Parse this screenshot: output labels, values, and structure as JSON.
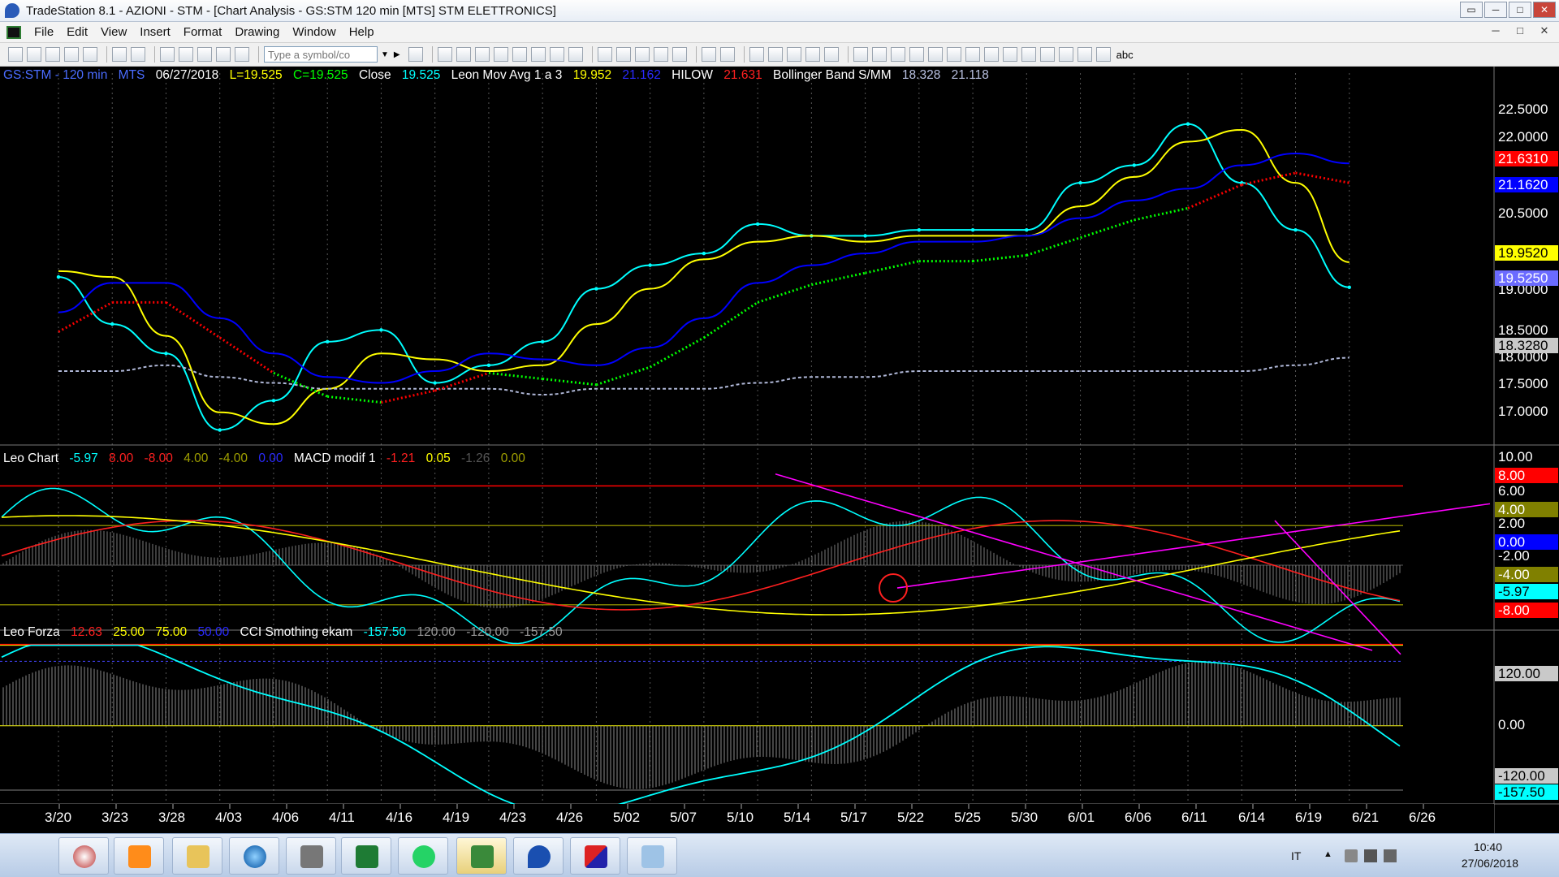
{
  "window": {
    "title": "TradeStation 8.1 - AZIONI - STM - [Chart Analysis - GS:STM  120 min  [MTS] STM ELETTRONICS]",
    "buttons": [
      "▭",
      "─",
      "□",
      "✕"
    ]
  },
  "menu": {
    "items": [
      "File",
      "Edit",
      "View",
      "Insert",
      "Format",
      "Drawing",
      "Window",
      "Help"
    ],
    "mdi_buttons": [
      "─",
      "□",
      "✕"
    ]
  },
  "toolbar": {
    "symbol_placeholder": "Type a symbol/co",
    "abc_label": "abc"
  },
  "price_panel": {
    "header": {
      "symbol": "GS:STM - 120 min",
      "mts": "MTS",
      "date": "06/27/2018",
      "low": "L=19.525",
      "close_val": "C=19.525",
      "close_label": "Close",
      "close": "19.525",
      "leon_label": "Leon Mov Avg 1 a 3",
      "leon1": "19.952",
      "leon2": "21.162",
      "hilow_label": "HILOW",
      "hilow": "21.631",
      "bb_label": "Bollinger Band S/MM",
      "bb1": "18.328",
      "bb2": "21.118"
    },
    "axis_ticks": [
      "22.5000",
      "22.0000",
      "20.5000",
      "19.0000",
      "18.5000",
      "18.0000",
      "17.5000",
      "17.0000"
    ],
    "tags": [
      {
        "text": "21.6310",
        "bg": "#ff0000",
        "color": "#ffffff"
      },
      {
        "text": "21.1620",
        "bg": "#0000ff",
        "color": "#ffffff"
      },
      {
        "text": "19.9520",
        "bg": "#ffff00",
        "color": "#000000"
      },
      {
        "text": "19.5250",
        "bg": "#6b6bff",
        "color": "#ffffff"
      },
      {
        "text": "18.3280",
        "bg": "#c9c9c9",
        "color": "#000000"
      }
    ]
  },
  "leo_chart_panel": {
    "header": {
      "label": "Leo Chart",
      "v1": "-5.97",
      "v2": "8.00",
      "v3": "-8.00",
      "v4": "4.00",
      "v5": "-4.00",
      "v6": "0.00",
      "macd_label": "MACD modif 1",
      "m1": "-1.21",
      "m2": "0.05",
      "m3": "-1.26",
      "m4": "0.00"
    },
    "axis_ticks": [
      "10.00",
      "6.00",
      "2.00",
      "-2.00"
    ],
    "tags": [
      {
        "text": "8.00",
        "bg": "#ff0000",
        "color": "#ffffff"
      },
      {
        "text": "4.00",
        "bg": "#808000",
        "color": "#ffffff"
      },
      {
        "text": "0.00",
        "bg": "#0000ff",
        "color": "#ffffff"
      },
      {
        "text": "-4.00",
        "bg": "#808000",
        "color": "#ffffff"
      },
      {
        "text": "-5.97",
        "bg": "#00ffff",
        "color": "#000000"
      },
      {
        "text": "-8.00",
        "bg": "#ff0000",
        "color": "#ffffff"
      }
    ]
  },
  "leo_forza_panel": {
    "header": {
      "label": "Leo Forza",
      "f1": "12.63",
      "f2": "25.00",
      "f3": "75.00",
      "f4": "50.00",
      "cci_label": "CCI Smothing ekam",
      "c1": "-157.50",
      "c2": "120.00",
      "c3": "-120.00",
      "c4": "-157.50"
    },
    "axis_ticks": [
      "0.00"
    ],
    "tags": [
      {
        "text": "120.00",
        "bg": "#c9c9c9",
        "color": "#000000"
      },
      {
        "text": "-120.00",
        "bg": "#c9c9c9",
        "color": "#000000"
      },
      {
        "text": "-157.50",
        "bg": "#00ffff",
        "color": "#000000"
      }
    ]
  },
  "time_axis": {
    "labels": [
      "3/20",
      "3/23",
      "3/28",
      "4/03",
      "4/06",
      "4/11",
      "4/16",
      "4/19",
      "4/23",
      "4/26",
      "5/02",
      "5/07",
      "5/10",
      "5/14",
      "5/17",
      "5/22",
      "5/25",
      "5/30",
      "6/01",
      "6/06",
      "6/11",
      "6/14",
      "6/19",
      "6/21",
      "6/26"
    ]
  },
  "colors": {
    "price": "#00ffff",
    "ma_fast": "#ffff00",
    "ma_slow": "#0000ff",
    "hilow_up": "#00ff00",
    "hilow_down": "#ff0000",
    "bollinger": "#b0b8d8",
    "trendline": "#ff00ff"
  },
  "chart_data": {
    "type": "line",
    "title": "GS:STM - 120 min",
    "x": [
      "3/20",
      "3/23",
      "3/28",
      "4/03",
      "4/06",
      "4/11",
      "4/16",
      "4/19",
      "4/23",
      "4/26",
      "5/02",
      "5/07",
      "5/10",
      "5/14",
      "5/17",
      "5/22",
      "5/25",
      "5/30",
      "6/01",
      "6/06",
      "6/11",
      "6/14",
      "6/19",
      "6/21",
      "6/26"
    ],
    "ylim": [
      16.9,
      23.0
    ],
    "series": [
      {
        "name": "Close",
        "values": [
          19.7,
          18.9,
          18.4,
          17.1,
          17.6,
          18.6,
          18.8,
          17.9,
          18.2,
          18.6,
          19.5,
          19.9,
          20.1,
          20.6,
          20.4,
          20.4,
          20.5,
          20.5,
          20.5,
          21.3,
          21.6,
          22.3,
          21.3,
          20.5,
          19.525
        ]
      },
      {
        "name": "Leon Mov Avg 1 a 3",
        "values": [
          19.8,
          19.7,
          18.7,
          17.4,
          17.2,
          17.8,
          18.4,
          18.3,
          18.1,
          18.2,
          18.9,
          19.5,
          20.0,
          20.3,
          20.4,
          20.3,
          20.4,
          20.4,
          20.4,
          20.9,
          21.4,
          22.0,
          22.2,
          21.3,
          19.952
        ]
      },
      {
        "name": "HILOW",
        "values": [
          19.1,
          19.6,
          19.6,
          19.0,
          18.4,
          18.0,
          17.9,
          18.1,
          18.4,
          18.3,
          18.2,
          18.5,
          19.0,
          19.6,
          19.9,
          20.1,
          20.3,
          20.3,
          20.4,
          20.7,
          21.0,
          21.2,
          21.6,
          21.8,
          21.631
        ]
      },
      {
        "name": "Bollinger Band S/MM",
        "values": [
          18.1,
          18.1,
          18.2,
          18.0,
          17.9,
          17.8,
          17.8,
          17.8,
          17.8,
          17.7,
          17.8,
          17.8,
          17.8,
          17.9,
          18.0,
          18.0,
          18.1,
          18.1,
          18.1,
          18.1,
          18.1,
          18.1,
          18.1,
          18.2,
          18.328
        ]
      }
    ]
  },
  "taskbar": {
    "tray_lang": "IT",
    "time": "10:40",
    "date": "27/06/2018"
  }
}
